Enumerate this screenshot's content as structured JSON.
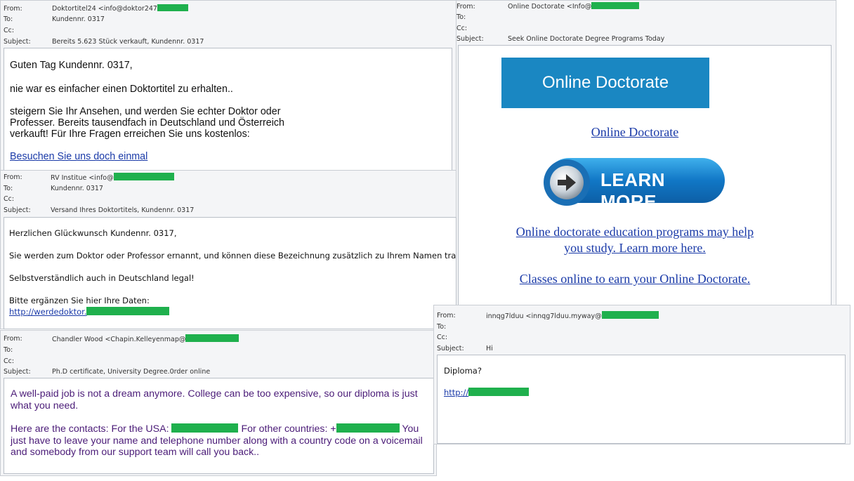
{
  "labels": {
    "from": "From:",
    "to": "To:",
    "cc": "Cc:",
    "subject": "Subject:"
  },
  "email1": {
    "from": "Doktortitel24 <info@doktor247",
    "to": "Kundennr. 0317",
    "subject": "Bereits 5.623 Stück verkauft, Kundennr. 0317",
    "greeting": "Guten Tag Kundennr. 0317,",
    "line1": "nie war es einfacher einen Doktortitel zu erhalten..",
    "para_l1": "steigern Sie Ihr Ansehen, und werden Sie echter Doktor oder",
    "para_l2": "Professer. Bereits tausendfach in Deutschland und Österreich",
    "para_l3": "verkauft! Für Ihre Fragen erreichen Sie uns kostenlos:",
    "link": "Besuchen Sie uns doch einmal"
  },
  "email2": {
    "from": "RV Institue <info@",
    "to": "Kundennr. 0317",
    "subject": "Versand Ihres Doktortitels, Kundennr. 0317",
    "greeting": "Herzlichen Glückwunsch Kundennr. 0317,",
    "line1": "Sie werden zum Doktor oder Professor ernannt, und können diese Bezeichnung zusätzlich zu Ihrem Namen tragen.",
    "line2": "Selbstverständlich auch in Deutschland legal!",
    "line3": "Bitte ergänzen Sie hier Ihre Daten:",
    "link": "http://werdedoktor."
  },
  "email3": {
    "from": "Chandler Wood <Chapin.Kelleyenmap@",
    "subject": "Ph.D certificate,  University  Degree.0rder  online",
    "para1": "A well-paid job is not a dream anymore. College can be too expensive, so our diploma is just what you need.",
    "para2_a": "Here are the contacts: For the USA:",
    "para2_b": "For other countries: +",
    "para2_c": "You just have to leave your name and telephone number along with a country code on a voicemail and somebody from our support team will call you back.."
  },
  "email4": {
    "from": "Online Doctorate <Info@",
    "subject": "Seek Online Doctorate Degree Programs Today",
    "banner": "Online Doctorate",
    "link_title": "Online Doctorate",
    "learn_more": "LEARN MORE",
    "link2_l1": "Online doctorate education programs may help",
    "link2_l2": "you study. Learn more here.",
    "link3": "Classes online to earn your Online Doctorate.",
    "banner_color": "#1a87c2"
  },
  "email5": {
    "from": "innqg7lduu <innqg7lduu.myway@",
    "subject": "Hi",
    "line1": "Diploma?",
    "link": "http://"
  },
  "colors": {
    "redaction": "#1fb04d",
    "link": "#1a3aa8",
    "purple_text": "#4b1c78"
  }
}
